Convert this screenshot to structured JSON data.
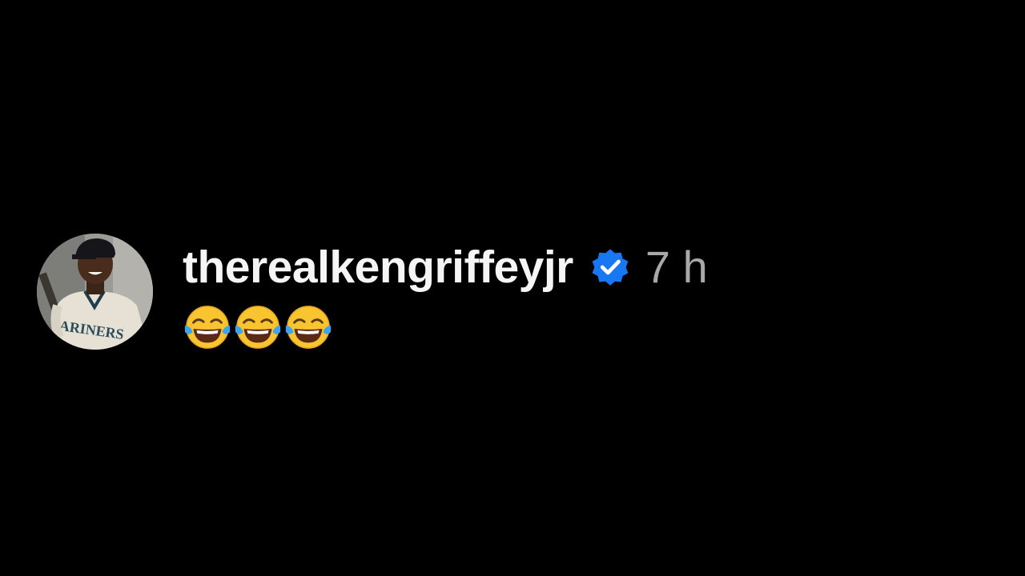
{
  "comment": {
    "username": "therealkengriffeyjr",
    "verified": true,
    "timestamp": "7 h",
    "text_emojis": [
      "face-with-tears-of-joy",
      "face-with-tears-of-joy",
      "face-with-tears-of-joy"
    ],
    "avatar_jersey_text": "ARINERS"
  },
  "colors": {
    "background": "#000000",
    "username": "#f5f5f5",
    "timestamp": "#a8a8a8",
    "verified_badge": "#1877f2"
  }
}
